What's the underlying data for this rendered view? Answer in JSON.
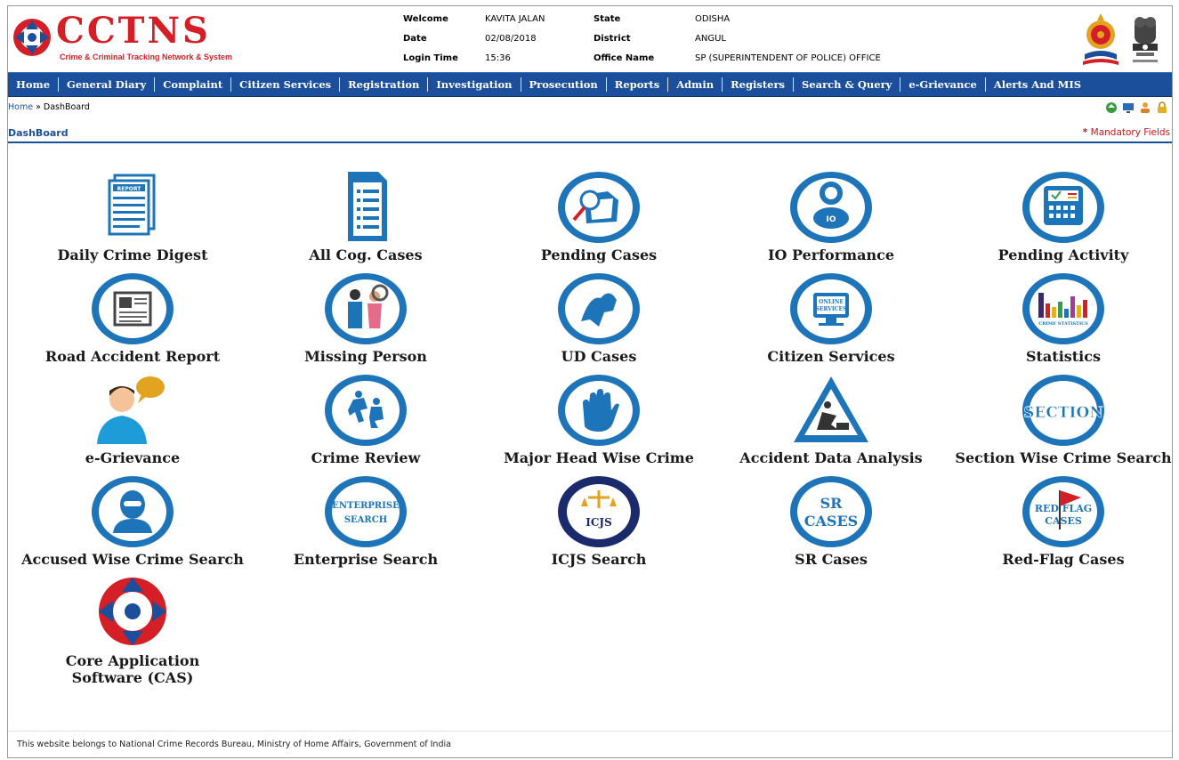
{
  "header": {
    "logo_title": "CCTNS",
    "logo_subtitle": "Crime & Criminal Tracking Network & System",
    "info": {
      "welcome_label": "Welcome",
      "welcome_value": "KAVITA JALAN",
      "date_label": "Date",
      "date_value": "02/08/2018",
      "login_label": "Login Time",
      "login_value": "15:36",
      "state_label": "State",
      "state_value": "ODISHA",
      "district_label": "District",
      "district_value": "ANGUL",
      "office_label": "Office Name",
      "office_value": "SP (SUPERINTENDENT OF POLICE) OFFICE"
    }
  },
  "nav": {
    "items": [
      "Home",
      "General Diary",
      "Complaint",
      "Citizen Services",
      "Registration",
      "Investigation",
      "Prosecution",
      "Reports",
      "Admin",
      "Registers",
      "Search & Query",
      "e-Grievance",
      "Alerts And MIS"
    ]
  },
  "breadcrumb": {
    "home": "Home",
    "separator": " » ",
    "current": "DashBoard"
  },
  "page": {
    "title": "DashBoard",
    "mandatory_star": "*",
    "mandatory_text": " Mandatory Fields"
  },
  "tiles": [
    {
      "label": "Daily Crime Digest",
      "icon": "report-icon"
    },
    {
      "label": "All Cog. Cases",
      "icon": "document-list-icon"
    },
    {
      "label": "Pending Cases",
      "icon": "folder-search-icon"
    },
    {
      "label": "IO Performance",
      "icon": "io-performance-icon"
    },
    {
      "label": "Pending Activity",
      "icon": "pending-activity-icon"
    },
    {
      "label": "Road Accident Report",
      "icon": "newspaper-icon"
    },
    {
      "label": "Missing Person",
      "icon": "missing-person-icon"
    },
    {
      "label": "UD Cases",
      "icon": "ud-cases-icon"
    },
    {
      "label": "Citizen Services",
      "icon": "online-services-icon"
    },
    {
      "label": "Statistics",
      "icon": "statistics-icon"
    },
    {
      "label": "e-Grievance",
      "icon": "user-chat-icon"
    },
    {
      "label": "Crime Review",
      "icon": "crime-review-icon"
    },
    {
      "label": "Major Head Wise Crime",
      "icon": "hand-stop-icon"
    },
    {
      "label": "Accident Data Analysis",
      "icon": "warning-sign-icon"
    },
    {
      "label": "Section Wise Crime Search",
      "icon": "section-icon"
    },
    {
      "label": "Accused Wise Crime Search",
      "icon": "masked-person-icon"
    },
    {
      "label": "Enterprise Search",
      "icon": "enterprise-search-icon"
    },
    {
      "label": "ICJS Search",
      "icon": "icjs-icon"
    },
    {
      "label": "SR Cases",
      "icon": "sr-cases-icon"
    },
    {
      "label": "Red-Flag Cases",
      "icon": "red-flag-icon"
    },
    {
      "label": "Core Application Software (CAS)",
      "icon": "cas-logo-icon"
    }
  ],
  "icon_text": {
    "report": "REPORT",
    "online": "ONLINE",
    "services": "SERVICES",
    "crime_stats": "CRIME STATISTICS",
    "section": "SECTION",
    "enterprise": "ENTERPRISE",
    "search": "SEARCH",
    "icjs": "ICJS",
    "sr": "SR",
    "cases": "CASES",
    "red_flag": "RED FLAG"
  },
  "footer": {
    "text": "This website belongs to National Crime Records Bureau, Ministry of Home Affairs, Government of India"
  },
  "colors": {
    "nav_bg": "#1b4f9c",
    "icon_blue": "#1d74b8",
    "brand_red": "#d41f26"
  }
}
